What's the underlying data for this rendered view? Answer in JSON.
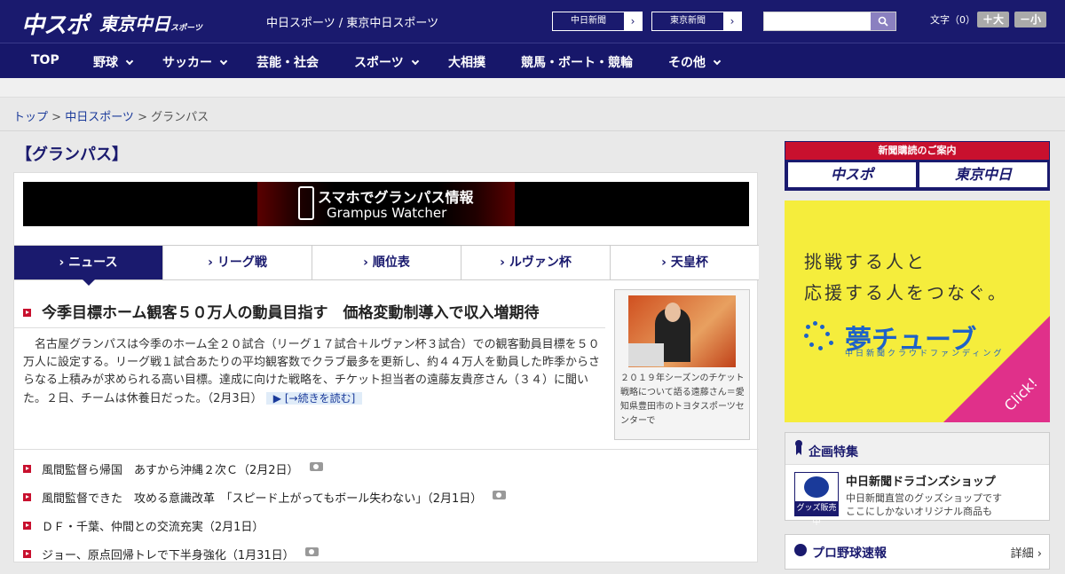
{
  "header": {
    "logo_chuspo": "中スポ",
    "logo_tokyo": "東京中日",
    "logo_tokyo_small": "スポーツ",
    "site_title": "中日スポーツ / 東京中日スポーツ",
    "btn_chunichi": "中日新聞",
    "btn_tokyo": "東京新聞",
    "arrow": "›",
    "search_value": "",
    "font_size_label": "文字（0）",
    "font_up": "＋大",
    "font_down": "－小"
  },
  "nav": {
    "items": [
      "TOP",
      "野球",
      "サッカー",
      "芸能・社会",
      "スポーツ",
      "大相撲",
      "競馬・ボート・競輪",
      "その他"
    ]
  },
  "breadcrumb": {
    "top": "トップ",
    "sep1": " > ",
    "chunichi": "中日スポーツ",
    "sep2": " > ",
    "current": "グランパス"
  },
  "page_title": "【グランパス】",
  "banner": {
    "line1": "スマホでグランパス情報",
    "line2": "Grampus Watcher"
  },
  "tabs": [
    "› ニュース",
    "› リーグ戦",
    "› 順位表",
    "› ルヴァン杯",
    "› 天皇杯"
  ],
  "headline": {
    "title": "今季目標ホーム観客５０万人の動員目指す　価格変動制導入で収入増期待",
    "lead": "名古屋グランパスは今季のホーム全２０試合（リーグ１７試合＋ルヴァン杯３試合）での観客動員目標を５０万人に設定する。リーグ戦１試合あたりの平均観客数でクラブ最多を更新し、約４４万人を動員した昨季からさらなる上積みが求められる高い目標。達成に向けた戦略を、チケット担当者の遠藤友貴彦さん（３４）に聞いた。２日、チームは休養日だった。（2月3日）",
    "more": "▶ [→続きを読む]",
    "caption": "２０１９年シーズンのチケット戦略について語る遠藤さん＝愛知県豊田市のトヨタスポーツセンターで"
  },
  "news_list": [
    {
      "text": "風間監督ら帰国　あすから沖縄２次Ｃ（2月2日）",
      "photo": true
    },
    {
      "text": "風間監督できた　攻める意識改革　「スピード上がってもボール失わない」（2月1日）",
      "photo": true
    },
    {
      "text": "ＤＦ・千葉、仲間との交流充実（2月1日）",
      "photo": false
    },
    {
      "text": "ジョー、原点回帰トレで下半身強化（1月31日）",
      "photo": true
    }
  ],
  "sidebar": {
    "subscribe_title": "新聞購読のご案内",
    "sub_chuspo": "中スポ",
    "sub_tokyo": "東京中日",
    "ad": {
      "line1": "挑戦する人と",
      "line2": "応援する人をつなぐ。",
      "brand": "夢チューブ",
      "sub": "中日新聞クラウドファンディング",
      "click": "Click!"
    },
    "special": {
      "title": "企画特集",
      "shop_label": "グッズ販売中",
      "shop_title": "中日新聞ドラゴンズショップ",
      "desc1": "中日新聞直営のグッズショップです",
      "desc2": "ここにしかないオリジナル商品も"
    },
    "baseball": {
      "title": "プロ野球速報",
      "detail": "詳細 ›"
    }
  },
  "colors": {
    "navy": "#1a1a6e",
    "red": "#c8102e",
    "ad_yellow": "#f5ed3c",
    "ad_blue": "#1e62c8",
    "ad_pink": "#e0308a"
  }
}
